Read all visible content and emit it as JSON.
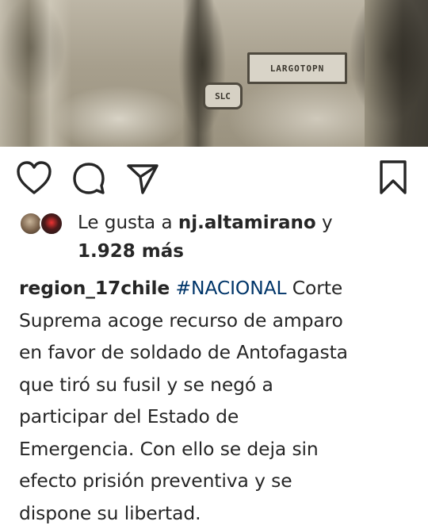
{
  "photo": {
    "patch_text": "LARGOTOPN",
    "patch2_text": "SLC"
  },
  "actions": {
    "like_icon": "heart-icon",
    "comment_icon": "comment-icon",
    "share_icon": "send-icon",
    "save_icon": "bookmark-icon"
  },
  "likes": {
    "prefix": "Le gusta a ",
    "user": "nj.altamirano",
    "suffix": " y",
    "others": "1.928 más"
  },
  "caption": {
    "username": "region_17chile",
    "hashtag": "#NACIONAL",
    "line1_rest": " Corte",
    "lines": [
      "Suprema acoge recurso de amparo",
      "en favor de soldado de Antofagasta",
      "que tiró su fusil y se negó a",
      "participar del Estado de",
      "Emergencia. Con ello se deja sin",
      "efecto prisión preventiva y se",
      "dispone su libertad."
    ]
  },
  "colors": {
    "text": "#262626",
    "hashtag": "#003569",
    "background": "#ffffff"
  }
}
